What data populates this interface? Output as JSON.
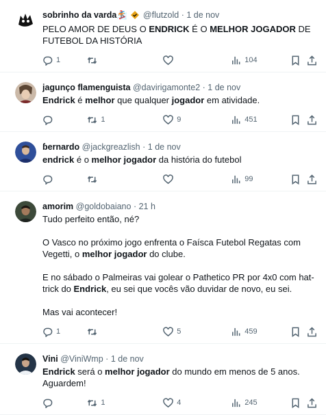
{
  "tweets": [
    {
      "name": "sobrinho da varda",
      "emoji": "🏂",
      "handle": "@flutzold",
      "sep": "·",
      "time": "1 de nov",
      "segments": [
        {
          "t": "PELO AMOR DE DEUS O "
        },
        {
          "t": "ENDRICK",
          "b": true
        },
        {
          "t": " É O "
        },
        {
          "t": "MELHOR JOGADOR",
          "b": true
        },
        {
          "t": " DE FUTEBOL DA HISTÓRIA"
        }
      ],
      "replies": "1",
      "retweets": "",
      "likes": "",
      "views": "104",
      "avatar": {
        "bg": "#ffffff",
        "fg": "#111111"
      }
    },
    {
      "name": "jagunço flamenguista",
      "handle": "@davirigamonte2",
      "sep": "·",
      "time": "1 de nov",
      "segments": [
        {
          "t": "Endrick",
          "b": true
        },
        {
          "t": " é "
        },
        {
          "t": "melhor",
          "b": true
        },
        {
          "t": " que qualquer "
        },
        {
          "t": "jogador",
          "b": true
        },
        {
          "t": " em atividade."
        }
      ],
      "replies": "",
      "retweets": "1",
      "likes": "9",
      "views": "451",
      "avatar": {
        "bg": "#cbb9a8",
        "fg": "#5b4634"
      }
    },
    {
      "name": "ɓernardo",
      "handle": "@jackgreazlish",
      "sep": "·",
      "time": "1 de nov",
      "segments": [
        {
          "t": "endrick",
          "b": true
        },
        {
          "t": " é o "
        },
        {
          "t": "melhor jogador",
          "b": true
        },
        {
          "t": " da história do futebol"
        }
      ],
      "replies": "",
      "retweets": "",
      "likes": "",
      "views": "99",
      "avatar": {
        "bg": "#2f4f9a",
        "fg": "#c8d2ee"
      }
    },
    {
      "name": "amorim",
      "handle": "@goldobaiano",
      "sep": "·",
      "time": "21 h",
      "paragraphs": [
        [
          {
            "t": "Tudo perfeito então, né?"
          }
        ],
        [
          {
            "t": "O Vasco no próximo jogo enfrenta o Faísca Futebol Regatas com Vegetti, o "
          },
          {
            "t": "melhor jogador",
            "b": true
          },
          {
            "t": " do clube."
          }
        ],
        [
          {
            "t": "E no sábado o Palmeiras vai golear o Pathetico PR por 4x0 com hat-trick do "
          },
          {
            "t": "Endrick",
            "b": true
          },
          {
            "t": ", eu sei que vocês vão duvidar de novo, eu sei."
          }
        ],
        [
          {
            "t": "Mas vai acontecer!"
          }
        ]
      ],
      "replies": "1",
      "retweets": "",
      "likes": "5",
      "views": "459",
      "avatar": {
        "bg": "#3d4a3a",
        "fg": "#d9c2a8"
      }
    },
    {
      "name": "Vini",
      "handle": "@ViniWmp",
      "sep": "·",
      "time": "1 de nov",
      "segments": [
        {
          "t": "Endrick",
          "b": true
        },
        {
          "t": " será o "
        },
        {
          "t": "melhor jogador",
          "b": true
        },
        {
          "t": " do mundo em menos de 5 anos. Aguardem!"
        }
      ],
      "replies": "",
      "retweets": "1",
      "likes": "4",
      "views": "245",
      "avatar": {
        "bg": "#243447",
        "fg": "#dfe6ee"
      }
    }
  ]
}
